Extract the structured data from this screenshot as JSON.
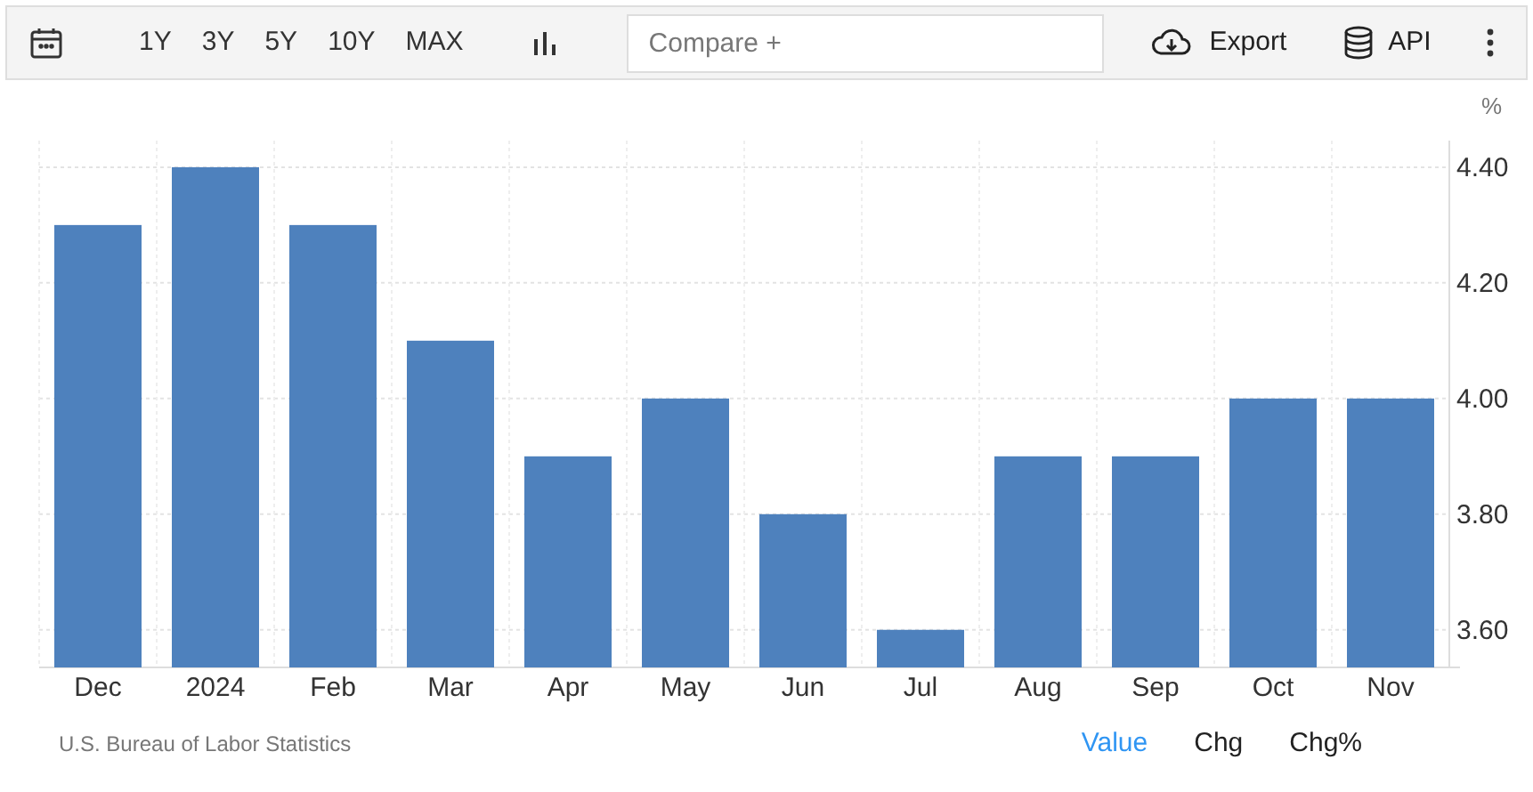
{
  "toolbar": {
    "ranges": [
      "1Y",
      "3Y",
      "5Y",
      "10Y",
      "MAX"
    ],
    "compare": {
      "placeholder": "Compare +"
    },
    "export": "Export",
    "api": "API"
  },
  "chart": {
    "chart_data": {
      "type": "bar",
      "ylabel": "%",
      "categories": [
        "Dec",
        "2024",
        "Feb",
        "Mar",
        "Apr",
        "May",
        "Jun",
        "Jul",
        "Aug",
        "Sep",
        "Oct",
        "Nov"
      ],
      "grid": true,
      "series": [
        {
          "color": "#4e81bd",
          "values": [
            4.3,
            4.4,
            4.3,
            4.1,
            3.9,
            4.0,
            3.8,
            3.6,
            3.9,
            3.9,
            4.0,
            4.0
          ]
        }
      ],
      "ylim": [
        3.535,
        4.446
      ],
      "yticks": [
        {
          "value": 3.6,
          "label": "3.60"
        },
        {
          "value": 3.8,
          "label": "3.80"
        },
        {
          "value": 4.0,
          "label": "4.00"
        },
        {
          "value": 4.2,
          "label": "4.20"
        },
        {
          "value": 4.4,
          "label": "4.40"
        }
      ]
    }
  },
  "footer": {
    "source": "U.S. Bureau of Labor Statistics",
    "modes": [
      {
        "label": "Value",
        "selected": true
      },
      {
        "label": "Chg",
        "selected": false
      },
      {
        "label": "Chg%",
        "selected": false
      }
    ]
  }
}
